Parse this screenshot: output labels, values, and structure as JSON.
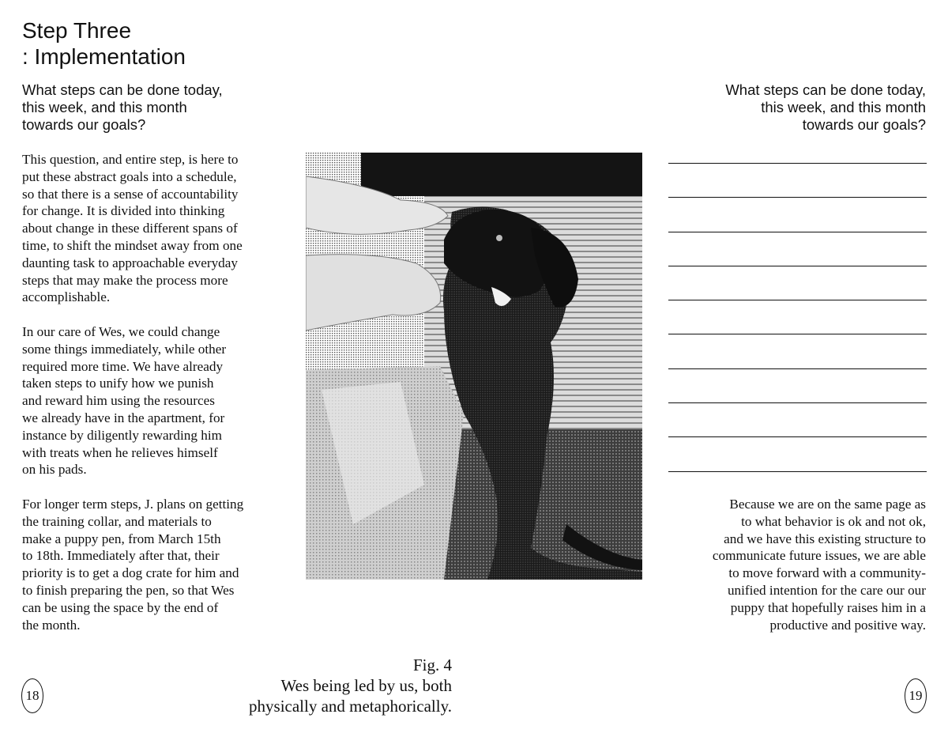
{
  "left_page": {
    "title_lines": [
      "Step Three",
      ": Implementation"
    ],
    "question_lines": [
      "What steps can be done today,",
      "this week, and this month",
      "towards our goals?"
    ],
    "paragraphs": [
      [
        "This question, and entire step, is here to",
        "put these abstract goals into a schedule,",
        "so that there is a sense of accountability",
        "for change. It is divided into thinking",
        "about change in these different spans of",
        "time, to shift the mindset away from one",
        "daunting task to approachable everyday",
        "steps that may make the process more",
        "accomplishable."
      ],
      [
        "In our care of Wes, we could change",
        "some things immediately, while other",
        "required more time. We have already",
        "taken steps to unify how we punish",
        "and reward him using the resources",
        "we already have in the apartment, for",
        "instance by diligently rewarding him",
        "with treats when he relieves himself",
        "on his pads."
      ],
      [
        "For longer term steps, J. plans on getting",
        "the training collar, and materials to",
        "make a puppy pen, from March 15th",
        "to 18th. Immediately after that, their",
        "priority is to get a dog crate for him and",
        "to finish preparing the pen, so that Wes",
        "can be using the space by the end of",
        "the month."
      ]
    ],
    "caption_lines": [
      "Fig. 4",
      "Wes being led by us, both",
      "physically and metaphorically."
    ],
    "page_number": "18"
  },
  "right_page": {
    "question_lines": [
      "What steps can be done today,",
      "this week, and this month",
      "towards our goals?"
    ],
    "answer_line_count": 10,
    "body_lines": [
      "Because we are on the same page as",
      "to what behavior is ok and not ok,",
      "and we have this existing structure to",
      "communicate future issues, we are able",
      "to move forward with a community-",
      "unified intention for the care our our",
      "puppy that hopefully raises him in a",
      "productive and positive way."
    ],
    "page_number": "19"
  },
  "colors": {
    "ink": "#111111",
    "paper": "#ffffff"
  }
}
